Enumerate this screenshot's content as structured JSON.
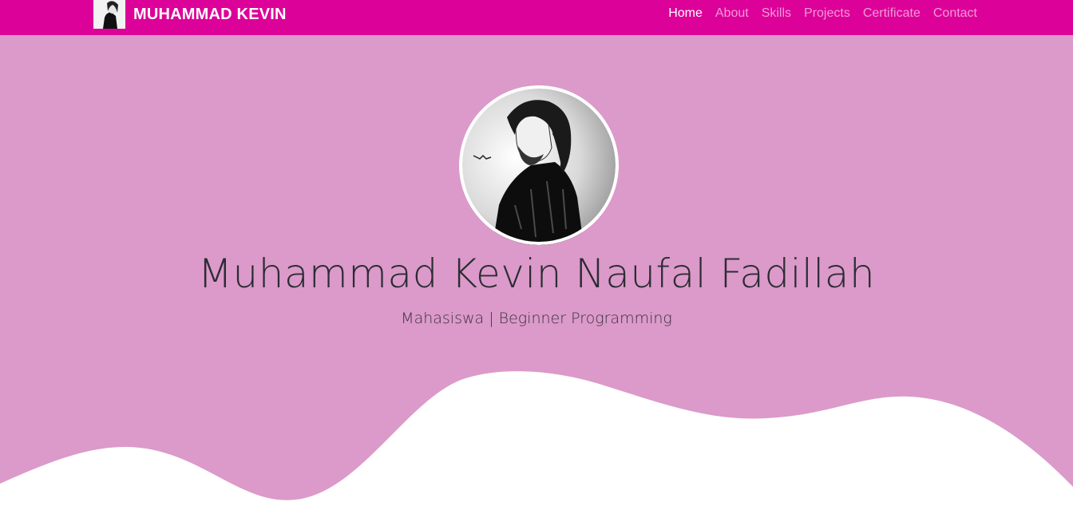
{
  "navbar": {
    "brand_name": "MUHAMMAD KEVIN",
    "links": [
      {
        "label": "Home",
        "active": true
      },
      {
        "label": "About",
        "active": false
      },
      {
        "label": "Skills",
        "active": false
      },
      {
        "label": "Projects",
        "active": false
      },
      {
        "label": "Certificate",
        "active": false
      },
      {
        "label": "Contact",
        "active": false
      }
    ]
  },
  "hero": {
    "name": "Muhammad Kevin Naufal Fadillah",
    "subtitle": "Mahasiswa | Beginner Programming"
  },
  "colors": {
    "navbar": "#dc0199",
    "hero_bg": "#db9ac9",
    "wave": "#ffffff"
  }
}
